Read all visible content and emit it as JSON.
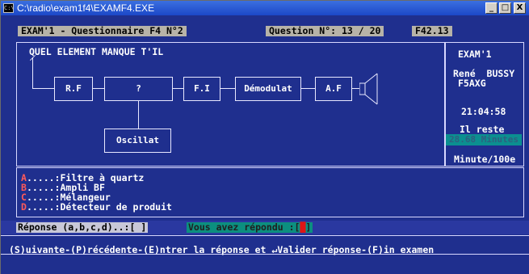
{
  "window": {
    "title": "C:\\radio\\exam1f4\\EXAMF4.EXE",
    "buttons": {
      "minimize": "_",
      "maximize": "□",
      "close": "X"
    }
  },
  "header": {
    "exam_title": "EXAM'1 - Questionnaire F4 N°2",
    "question_label": "Question N°: 13 / 20",
    "question_code": "F42.13"
  },
  "question": {
    "prompt": "QUEL ELEMENT MANQUE T'IL",
    "diagram": {
      "blocks": [
        "R.F",
        "?",
        "F.I",
        "Démodulat",
        "A.F"
      ],
      "oscillator": "Oscillat"
    }
  },
  "side_panel": {
    "exam": "EXAM'1",
    "author": "René  BUSSY",
    "callsign": "F5AXG",
    "clock": "21:04:58",
    "remaining_label": "Il reste",
    "remaining_value": "28.68 Minutes",
    "unit": "Minute/100e"
  },
  "answers": [
    {
      "key": "A",
      "text": ".....:Filtre à quartz"
    },
    {
      "key": "B",
      "text": ".....:Ampli BF"
    },
    {
      "key": "C",
      "text": ".....:Mélangeur"
    },
    {
      "key": "D",
      "text": ".....:Détecteur de produit"
    }
  ],
  "response": {
    "prompt": "Réponse (a,b,c,d)..:[ ]",
    "answered": "Vous avez répondu :[",
    "answered_cursor": "█",
    "answered_end": "]"
  },
  "footer": {
    "commands": "(S)uivante-(P)récédente-(E)ntrer la réponse et ↵Valider réponse-(F)in examen"
  }
}
